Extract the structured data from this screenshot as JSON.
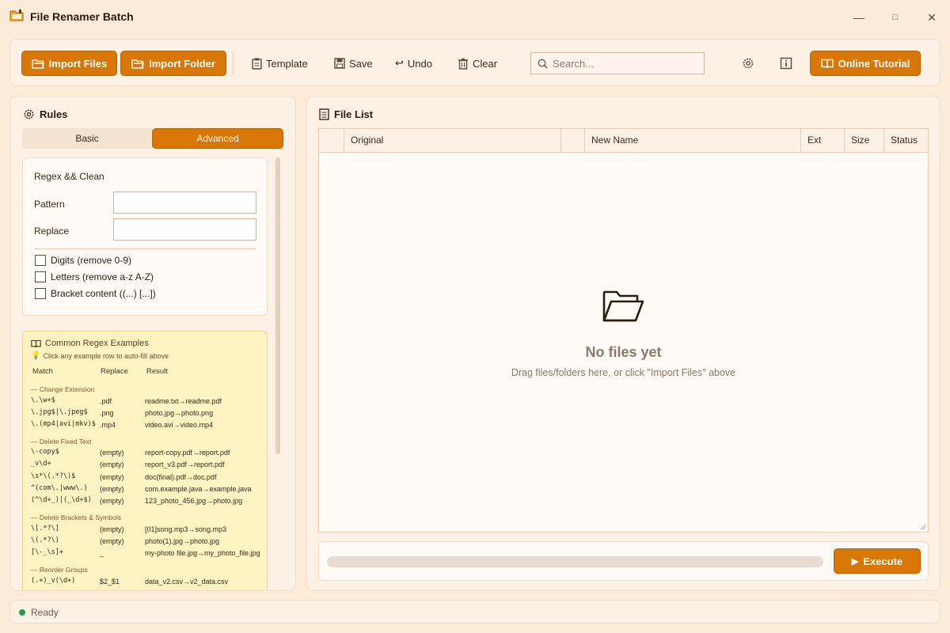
{
  "window": {
    "title": "File Renamer Batch",
    "controls": {
      "minimize": "—",
      "maximize": "□",
      "close": "✕"
    }
  },
  "toolbar": {
    "import_files": "Import Files",
    "import_folder": "Import Folder",
    "template": "Template",
    "save": "Save",
    "undo": "Undo",
    "clear": "Clear",
    "search_placeholder": "Search...",
    "online_tutorial": "Online Tutorial"
  },
  "rules": {
    "heading": "Rules",
    "tabs": [
      "Basic",
      "Advanced"
    ],
    "active_tab": "Advanced",
    "card_title": "Regex && Clean",
    "pattern_label": "Pattern",
    "pattern_value": "",
    "replace_label": "Replace",
    "replace_value": "",
    "checkboxes": [
      {
        "label": "Digits (remove 0-9)",
        "checked": false
      },
      {
        "label": "Letters (remove a-z A-Z)",
        "checked": false
      },
      {
        "label": "Bracket content ((...) [...])",
        "checked": false
      }
    ]
  },
  "regex_examples": {
    "title": "Common Regex Examples",
    "hint": "Click any example row to auto-fill above",
    "headers": {
      "match": "Match",
      "replace": "Replace",
      "result": "Result"
    },
    "sections": [
      {
        "name": "— Change Extension"
      },
      {
        "name": "— Delete Fixed Text"
      },
      {
        "name": "— Delete Brackets & Symbols"
      },
      {
        "name": "— Reorder Groups"
      }
    ],
    "rows": [
      {
        "match": "\\.\\w+$",
        "replace": ".pdf",
        "result": "readme.txt→readme.pdf"
      },
      {
        "match": "\\.jpg$|\\.jpeg$",
        "replace": ".png",
        "result": "photo.jpg→photo.png"
      },
      {
        "match": "\\.(mp4|avi|mkv)$",
        "replace": ".mp4",
        "result": "video.avi→video.mp4"
      },
      {
        "match": "\\-copy$",
        "replace": "(empty)",
        "result": "report-copy.pdf→report.pdf"
      },
      {
        "match": "_v\\d+",
        "replace": "(empty)",
        "result": "report_v3.pdf→report.pdf"
      },
      {
        "match": "\\s*\\(.*?\\)$",
        "replace": "(empty)",
        "result": "doc(final).pdf→doc.pdf"
      },
      {
        "match": "^(com\\.|www\\.)",
        "replace": "(empty)",
        "result": "com.example.java→example.java"
      },
      {
        "match": "(^\\d+_)|(_\\d+$)",
        "replace": "(empty)",
        "result": "123_photo_456.jpg→photo.jpg"
      },
      {
        "match": "\\[.*?\\]",
        "replace": "(empty)",
        "result": "[01]song.mp3→song.mp3"
      },
      {
        "match": "\\(.*?\\)",
        "replace": "(empty)",
        "result": "photo(1).jpg→photo.jpg"
      },
      {
        "match": "[\\-_\\s]+",
        "replace": "_",
        "result": "my-photo file.jpg→my_photo_file.jpg"
      },
      {
        "match": "(.+)_v(\\d+)",
        "replace": "$2_$1",
        "result": "data_v2.csv→v2_data.csv"
      }
    ]
  },
  "file_list": {
    "heading": "File List",
    "columns": [
      "Original",
      "New Name",
      "Ext",
      "Size",
      "Status"
    ],
    "empty_title": "No files yet",
    "empty_subtitle": "Drag files/folders here, or click \"Import Files\" above"
  },
  "execute": {
    "label": "Execute",
    "progress": 0
  },
  "status": {
    "text": "Ready",
    "color": "#1f9d4a"
  },
  "theme": {
    "accent": "#d97706",
    "background": "#fdebd9"
  }
}
